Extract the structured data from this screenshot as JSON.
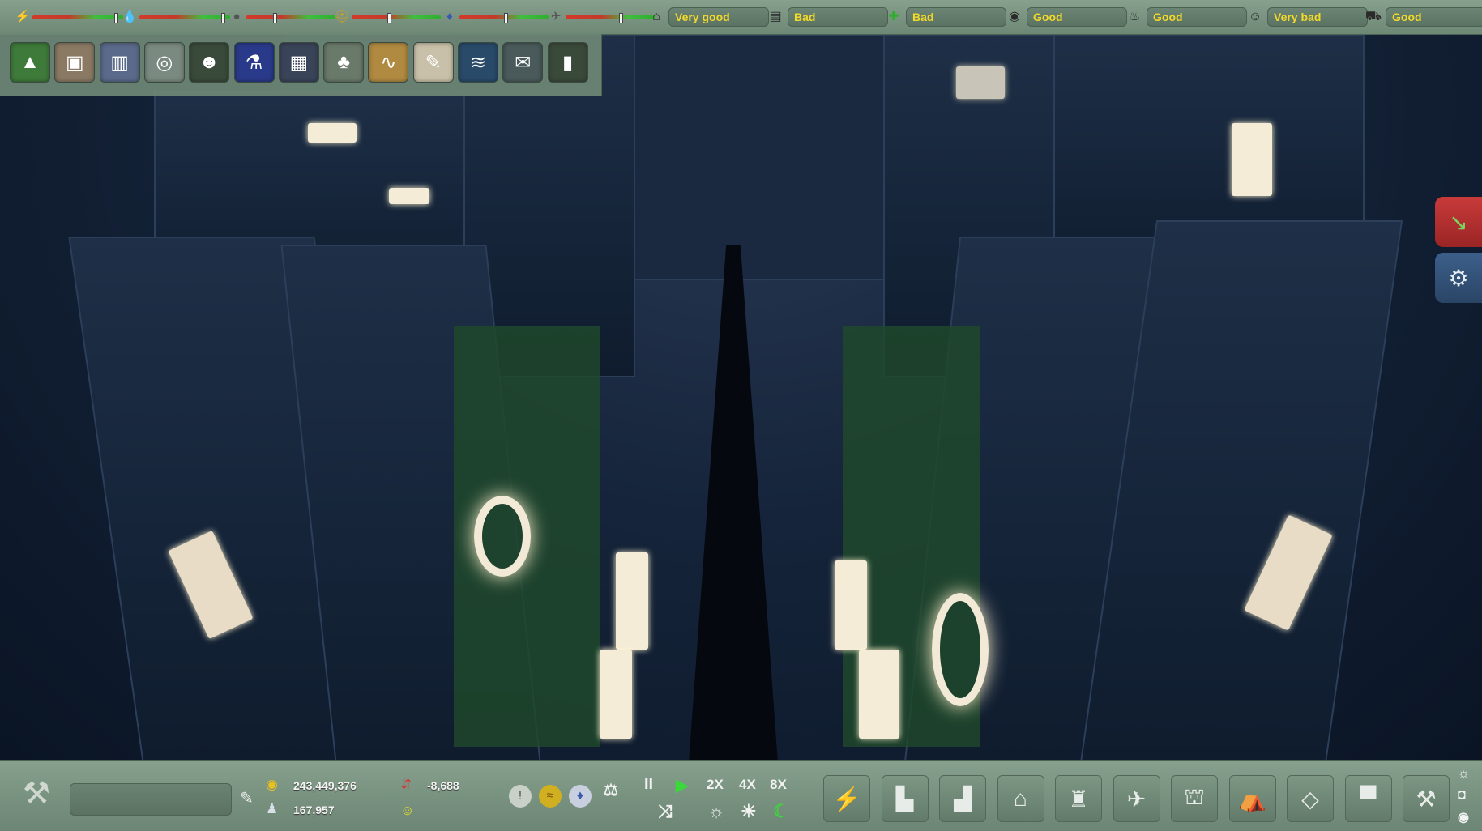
{
  "top_bar": {
    "meters": [
      {
        "icon": "power-icon",
        "glyph": "⚡",
        "level": 0.9,
        "color": "#e8c020"
      },
      {
        "icon": "water-drop-icon",
        "glyph": "💧",
        "level": 0.9,
        "color": "#3a8ad8"
      },
      {
        "icon": "waste-bag-icon",
        "glyph": "●",
        "level": 0.3,
        "color": "#555555"
      },
      {
        "icon": "worker-helmet-icon",
        "glyph": "⛑",
        "level": 0.4,
        "color": "#d0a020"
      },
      {
        "icon": "police-icon",
        "glyph": "♦",
        "level": 0.5,
        "color": "#3a5ab0"
      },
      {
        "icon": "traffic-icon",
        "glyph": "✈",
        "level": 0.6,
        "color": "#555555"
      }
    ],
    "statuses": [
      {
        "icon": "housing-icon",
        "glyph": "⌂",
        "label": "Very good"
      },
      {
        "icon": "education-book-icon",
        "glyph": "▤",
        "label": "Bad"
      },
      {
        "icon": "health-cross-icon",
        "glyph": "✚",
        "label": "Bad"
      },
      {
        "icon": "environment-icon",
        "glyph": "◉",
        "label": "Good"
      },
      {
        "icon": "fire-safety-icon",
        "glyph": "♨",
        "label": "Good"
      },
      {
        "icon": "entertainment-icon",
        "glyph": "☺",
        "label": "Very bad"
      },
      {
        "icon": "transport-icon",
        "glyph": "⛟",
        "label": "Good"
      }
    ]
  },
  "toolbar": {
    "tools": [
      {
        "icon": "terrain-tool-icon",
        "glyph": "▲",
        "color": "#3e7a3a"
      },
      {
        "icon": "blocks-tool-icon",
        "glyph": "▣",
        "color": "#8a7a64"
      },
      {
        "icon": "statistics-chart-icon",
        "glyph": "▥",
        "color": "#5a6a8a"
      },
      {
        "icon": "hologram-tool-icon",
        "glyph": "◎",
        "color": "#7a8a80"
      },
      {
        "icon": "citizens-icon",
        "glyph": "☻",
        "color": "#3a4a3a"
      },
      {
        "icon": "research-flask-icon",
        "glyph": "⚗",
        "color": "#2a3a8a"
      },
      {
        "icon": "roads-tool-icon",
        "glyph": "▦",
        "color": "#3a4458"
      },
      {
        "icon": "nature-tree-icon",
        "glyph": "♣",
        "color": "#6a7a6a"
      },
      {
        "icon": "economy-graph-icon",
        "glyph": "∿",
        "color": "#b08a40"
      },
      {
        "icon": "policy-scroll-icon",
        "glyph": "✎",
        "color": "#c8c0a8"
      },
      {
        "icon": "rail-tool-icon",
        "glyph": "≋",
        "color": "#2a4a6a"
      },
      {
        "icon": "mail-envelope-icon",
        "glyph": "✉",
        "color": "#4a5a5a"
      },
      {
        "icon": "library-books-icon",
        "glyph": "▮",
        "color": "#3a4a3a"
      }
    ]
  },
  "side": {
    "chart_button_icon": "trend-chart-icon",
    "settings_button_icon": "settings-gear-icon"
  },
  "bottom_bar": {
    "money": "243,449,376",
    "income": "-8,688",
    "population": "167,957",
    "speed_labels": [
      "2X",
      "4X",
      "8X"
    ],
    "pause_glyph": "II",
    "play_glyph": "▶",
    "build_icons": [
      {
        "icon": "build-power-icon",
        "glyph": "⚡"
      },
      {
        "icon": "build-residential-icon",
        "glyph": "▙"
      },
      {
        "icon": "build-commercial-icon",
        "glyph": "▟"
      },
      {
        "icon": "build-services-icon",
        "glyph": "⌂"
      },
      {
        "icon": "build-industry-icon",
        "glyph": "♜"
      },
      {
        "icon": "build-transport-icon",
        "glyph": "✈"
      },
      {
        "icon": "build-public-icon",
        "glyph": "⛫"
      },
      {
        "icon": "build-leisure-icon",
        "glyph": "⛺"
      },
      {
        "icon": "build-structure-icon",
        "glyph": "◇"
      },
      {
        "icon": "build-blocks-icon",
        "glyph": "▀"
      },
      {
        "icon": "build-bulldoze-icon",
        "glyph": "⚒"
      }
    ]
  }
}
